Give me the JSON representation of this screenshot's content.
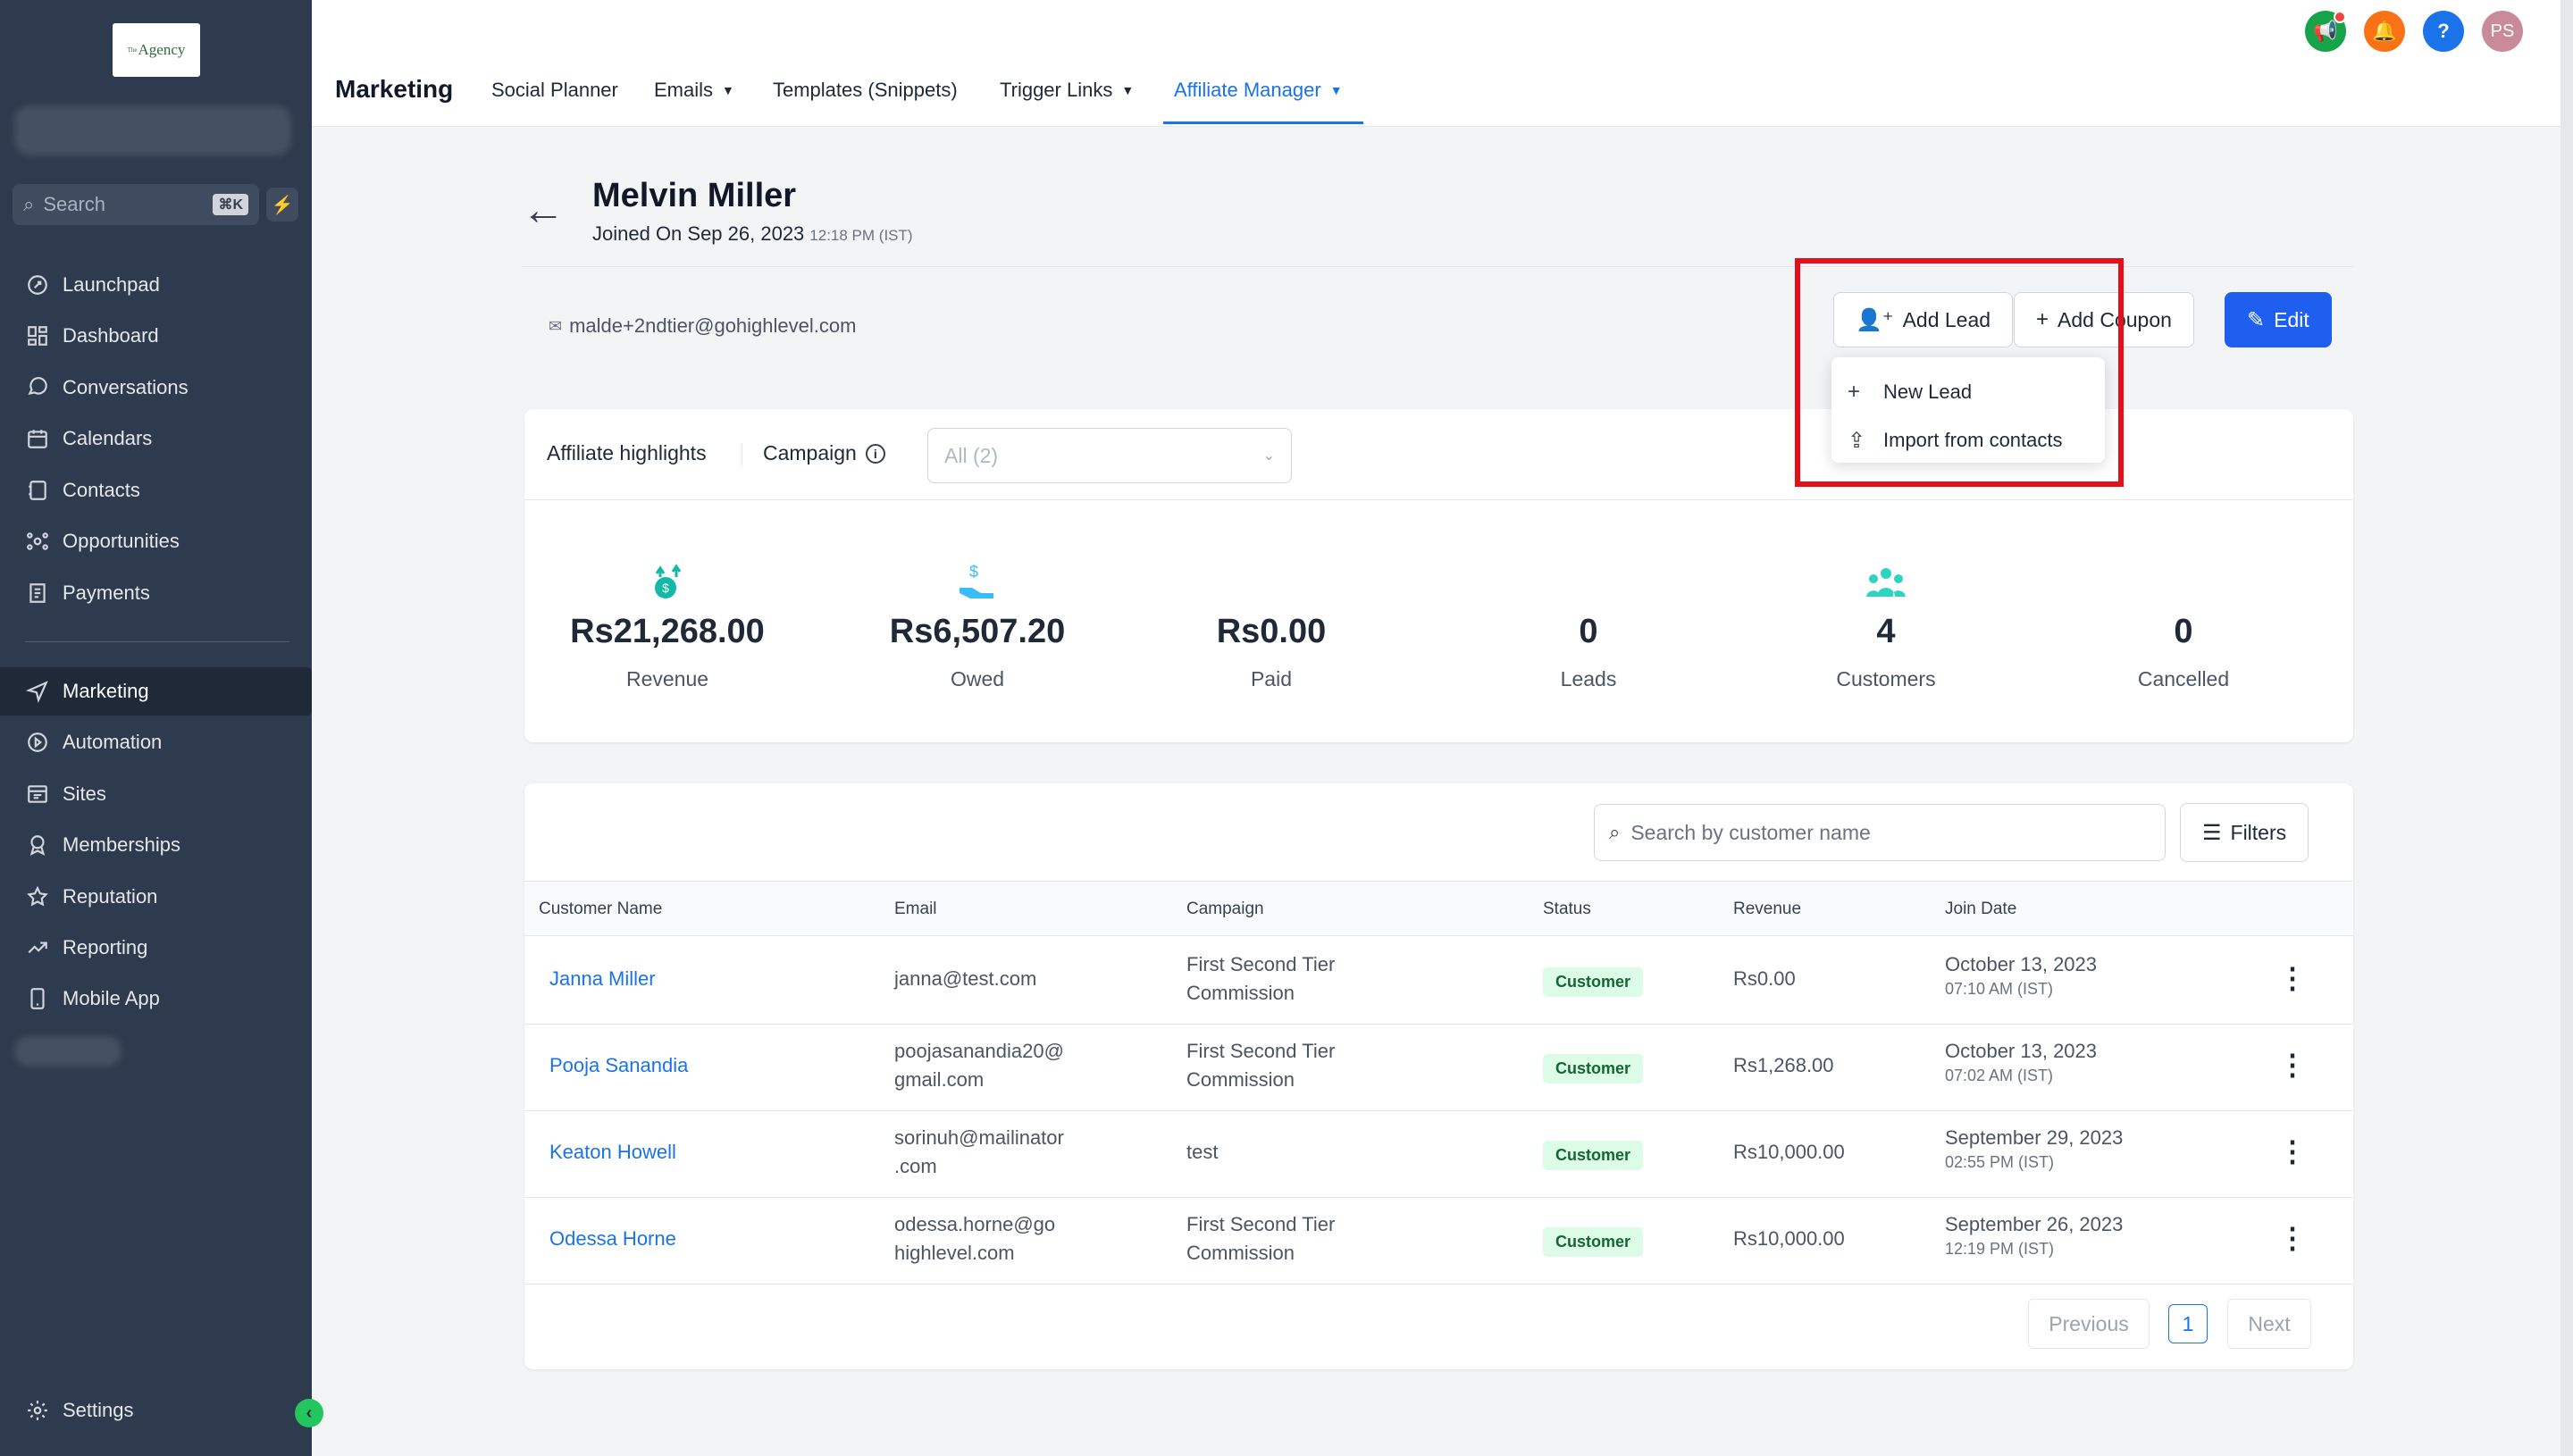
{
  "brand": {
    "logo_small": "The",
    "logo_text": "Agency"
  },
  "sidebar": {
    "search_placeholder": "Search",
    "search_shortcut": "⌘K",
    "items": [
      {
        "label": "Launchpad",
        "icon": "launchpad-icon"
      },
      {
        "label": "Dashboard",
        "icon": "dashboard-icon"
      },
      {
        "label": "Conversations",
        "icon": "conversations-icon"
      },
      {
        "label": "Calendars",
        "icon": "calendar-icon"
      },
      {
        "label": "Contacts",
        "icon": "contacts-icon"
      },
      {
        "label": "Opportunities",
        "icon": "opportunities-icon"
      },
      {
        "label": "Payments",
        "icon": "payments-icon"
      },
      {
        "label": "Marketing",
        "icon": "marketing-icon"
      },
      {
        "label": "Automation",
        "icon": "automation-icon"
      },
      {
        "label": "Sites",
        "icon": "sites-icon"
      },
      {
        "label": "Memberships",
        "icon": "memberships-icon"
      },
      {
        "label": "Reputation",
        "icon": "star-icon"
      },
      {
        "label": "Reporting",
        "icon": "reporting-icon"
      },
      {
        "label": "Mobile App",
        "icon": "mobile-icon"
      }
    ],
    "settings_label": "Settings"
  },
  "header": {
    "title": "Marketing",
    "tabs": [
      {
        "label": "Social Planner"
      },
      {
        "label": "Emails"
      },
      {
        "label": "Templates (Snippets)"
      },
      {
        "label": "Trigger Links"
      },
      {
        "label": "Affiliate Manager"
      }
    ],
    "avatar_initials": "PS"
  },
  "profile": {
    "name": "Melvin Miller",
    "joined": "Joined On Sep 26, 2023",
    "joined_time": "12:18 PM (IST)",
    "email": "malde+2ndtier@gohighlevel.com"
  },
  "actions": {
    "add_lead": "Add Lead",
    "add_coupon": "Add Coupon",
    "edit": "Edit",
    "menu": {
      "new_lead": "New Lead",
      "import": "Import from contacts"
    }
  },
  "highlights": {
    "label": "Affiliate highlights",
    "campaign_label": "Campaign",
    "campaign_value": "All (2)",
    "stats": [
      {
        "value": "Rs21,268.00",
        "label": "Revenue",
        "icon": "revenue-icon"
      },
      {
        "value": "Rs6,507.20",
        "label": "Owed",
        "icon": "owed-icon"
      },
      {
        "value": "Rs0.00",
        "label": "Paid",
        "icon": ""
      },
      {
        "value": "0",
        "label": "Leads",
        "icon": ""
      },
      {
        "value": "4",
        "label": "Customers",
        "icon": "customers-icon"
      },
      {
        "value": "0",
        "label": "Cancelled",
        "icon": ""
      }
    ]
  },
  "table": {
    "search_placeholder": "Search by customer name",
    "filters_label": "Filters",
    "columns": [
      "Customer Name",
      "Email",
      "Campaign",
      "Status",
      "Revenue",
      "Join Date"
    ],
    "rows": [
      {
        "name": "Janna Miller",
        "email": [
          "janna@test.com"
        ],
        "campaign": [
          "First Second Tier",
          "Commission"
        ],
        "status": "Customer",
        "revenue": "Rs0.00",
        "date": "October 13, 2023",
        "time": "07:10 AM (IST)"
      },
      {
        "name": "Pooja Sanandia",
        "email": [
          "poojasanandia20@",
          "gmail.com"
        ],
        "campaign": [
          "First Second Tier",
          "Commission"
        ],
        "status": "Customer",
        "revenue": "Rs1,268.00",
        "date": "October 13, 2023",
        "time": "07:02 AM (IST)"
      },
      {
        "name": "Keaton Howell",
        "email": [
          "sorinuh@mailinator",
          ".com"
        ],
        "campaign": [
          "test"
        ],
        "status": "Customer",
        "revenue": "Rs10,000.00",
        "date": "September 29, 2023",
        "time": "02:55 PM (IST)"
      },
      {
        "name": "Odessa Horne",
        "email": [
          "odessa.horne@go",
          "highlevel.com"
        ],
        "campaign": [
          "First Second Tier",
          "Commission"
        ],
        "status": "Customer",
        "revenue": "Rs10,000.00",
        "date": "September 26, 2023",
        "time": "12:19 PM (IST)"
      }
    ],
    "pagination": {
      "previous": "Previous",
      "current": "1",
      "next": "Next"
    }
  },
  "colors": {
    "accent": "#1a73e8",
    "primary_button": "#1e5ff0",
    "sidebar_bg": "#2e3a4d",
    "highlight_box": "#e3101b",
    "icon_teal": "#14b8a6"
  }
}
